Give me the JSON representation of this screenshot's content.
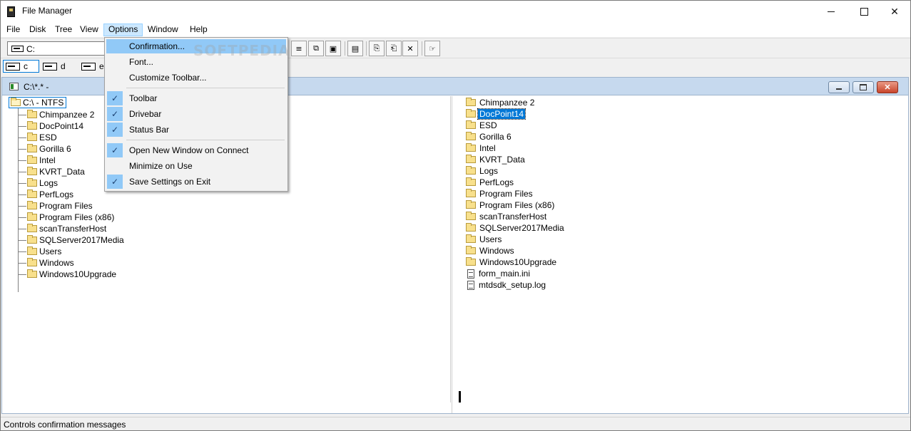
{
  "window": {
    "title": "File Manager"
  },
  "menubar": {
    "items": [
      "File",
      "Disk",
      "Tree",
      "View",
      "Options",
      "Window",
      "Help"
    ]
  },
  "toolbar": {
    "drive_combo": "C:"
  },
  "drivebar": {
    "drives": [
      "c",
      "d",
      "e"
    ]
  },
  "child_window": {
    "title": "C:\\*.* -",
    "tree_root": "C:\\ - NTFS",
    "tree_folders": [
      "Chimpanzee 2",
      "DocPoint14",
      "ESD",
      "Gorilla 6",
      "Intel",
      "KVRT_Data",
      "Logs",
      "PerfLogs",
      "Program Files",
      "Program Files (x86)",
      "scanTransferHost",
      "SQLServer2017Media",
      "Users",
      "Windows",
      "Windows10Upgrade"
    ],
    "file_folders": [
      "Chimpanzee 2",
      "DocPoint14",
      "ESD",
      "Gorilla 6",
      "Intel",
      "KVRT_Data",
      "Logs",
      "PerfLogs",
      "Program Files",
      "Program Files (x86)",
      "scanTransferHost",
      "SQLServer2017Media",
      "Users",
      "Windows",
      "Windows10Upgrade"
    ],
    "file_docs": [
      "form_main.ini",
      "mtdsdk_setup.log"
    ],
    "selected_file": "DocPoint14"
  },
  "options_menu": {
    "items": [
      {
        "label": "Confirmation...",
        "checked": false
      },
      {
        "label": "Font...",
        "checked": false
      },
      {
        "label": "Customize Toolbar...",
        "checked": false
      },
      {
        "label": "Toolbar",
        "checked": true
      },
      {
        "label": "Drivebar",
        "checked": true
      },
      {
        "label": "Status Bar",
        "checked": true
      },
      {
        "label": "Open New Window on Connect",
        "checked": true
      },
      {
        "label": "Minimize on Use",
        "checked": false
      },
      {
        "label": "Save Settings on Exit",
        "checked": true
      }
    ]
  },
  "watermark": "SOFTPEDIA",
  "statusbar": {
    "text": "Controls confirmation messages"
  },
  "colors": {
    "selection": "#0078d7",
    "menu_highlight": "#91c9f7",
    "child_title": "#c6d9ee"
  }
}
